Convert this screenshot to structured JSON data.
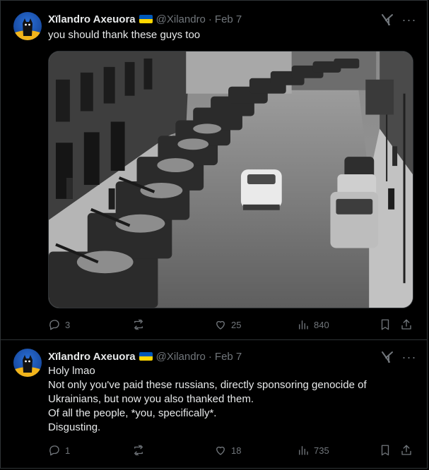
{
  "tweets": [
    {
      "author_name": "Xïlandro Axeuora",
      "handle": "@Xilandro",
      "separator": "·",
      "date": "Feb 7",
      "lines": [
        "you should thank these guys too"
      ],
      "replies": "3",
      "reposts": "",
      "likes": "25",
      "views": "840",
      "more_glyph": "···"
    },
    {
      "author_name": "Xïlandro Axeuora",
      "handle": "@Xilandro",
      "separator": "·",
      "date": "Feb 7",
      "lines": [
        "Holy lmao",
        "Not only you've paid these russians, directly sponsoring genocide of",
        "Ukrainians, but now you also thanked them.",
        "Of all the people, *you, specifically*.",
        "Disgusting."
      ],
      "replies": "1",
      "reposts": "",
      "likes": "18",
      "views": "735",
      "more_glyph": "···"
    }
  ],
  "colors": {
    "background": "#000000",
    "text_primary": "#e7e9ea",
    "text_secondary": "#71767b",
    "divider": "#2f3336",
    "flag_blue": "#0057b7",
    "flag_yellow": "#ffd700"
  },
  "icons": [
    "reply-icon",
    "repost-icon",
    "like-icon",
    "views-icon",
    "bookmark-icon",
    "share-icon",
    "grok-icon",
    "more-icon",
    "ukraine-flag-icon"
  ]
}
